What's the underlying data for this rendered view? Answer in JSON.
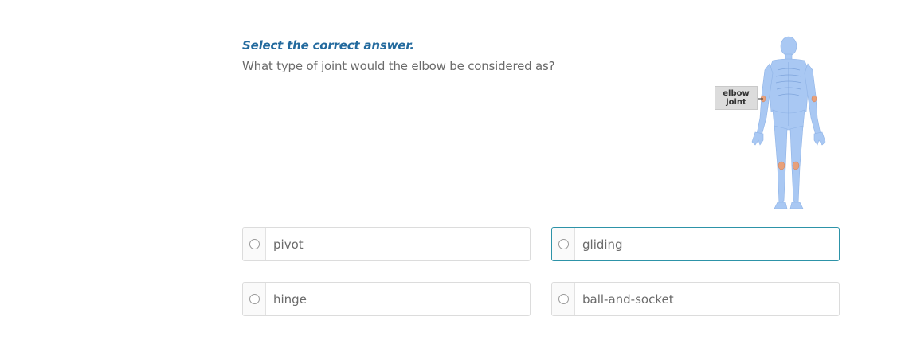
{
  "question": {
    "instruction": "Select the correct answer.",
    "prompt": "What type of joint would the elbow be considered as?"
  },
  "figure": {
    "label_line1": "elbow",
    "label_line2": "joint",
    "body_color": "#a9c8f3",
    "joint_color": "#e8a07a"
  },
  "options": [
    {
      "label": "pivot"
    },
    {
      "label": "gliding"
    },
    {
      "label": "hinge"
    },
    {
      "label": "ball-and-socket"
    }
  ],
  "colors": {
    "instruction": "#236a9e",
    "text": "#6b6b6b",
    "focus_border": "#2d93a8"
  }
}
